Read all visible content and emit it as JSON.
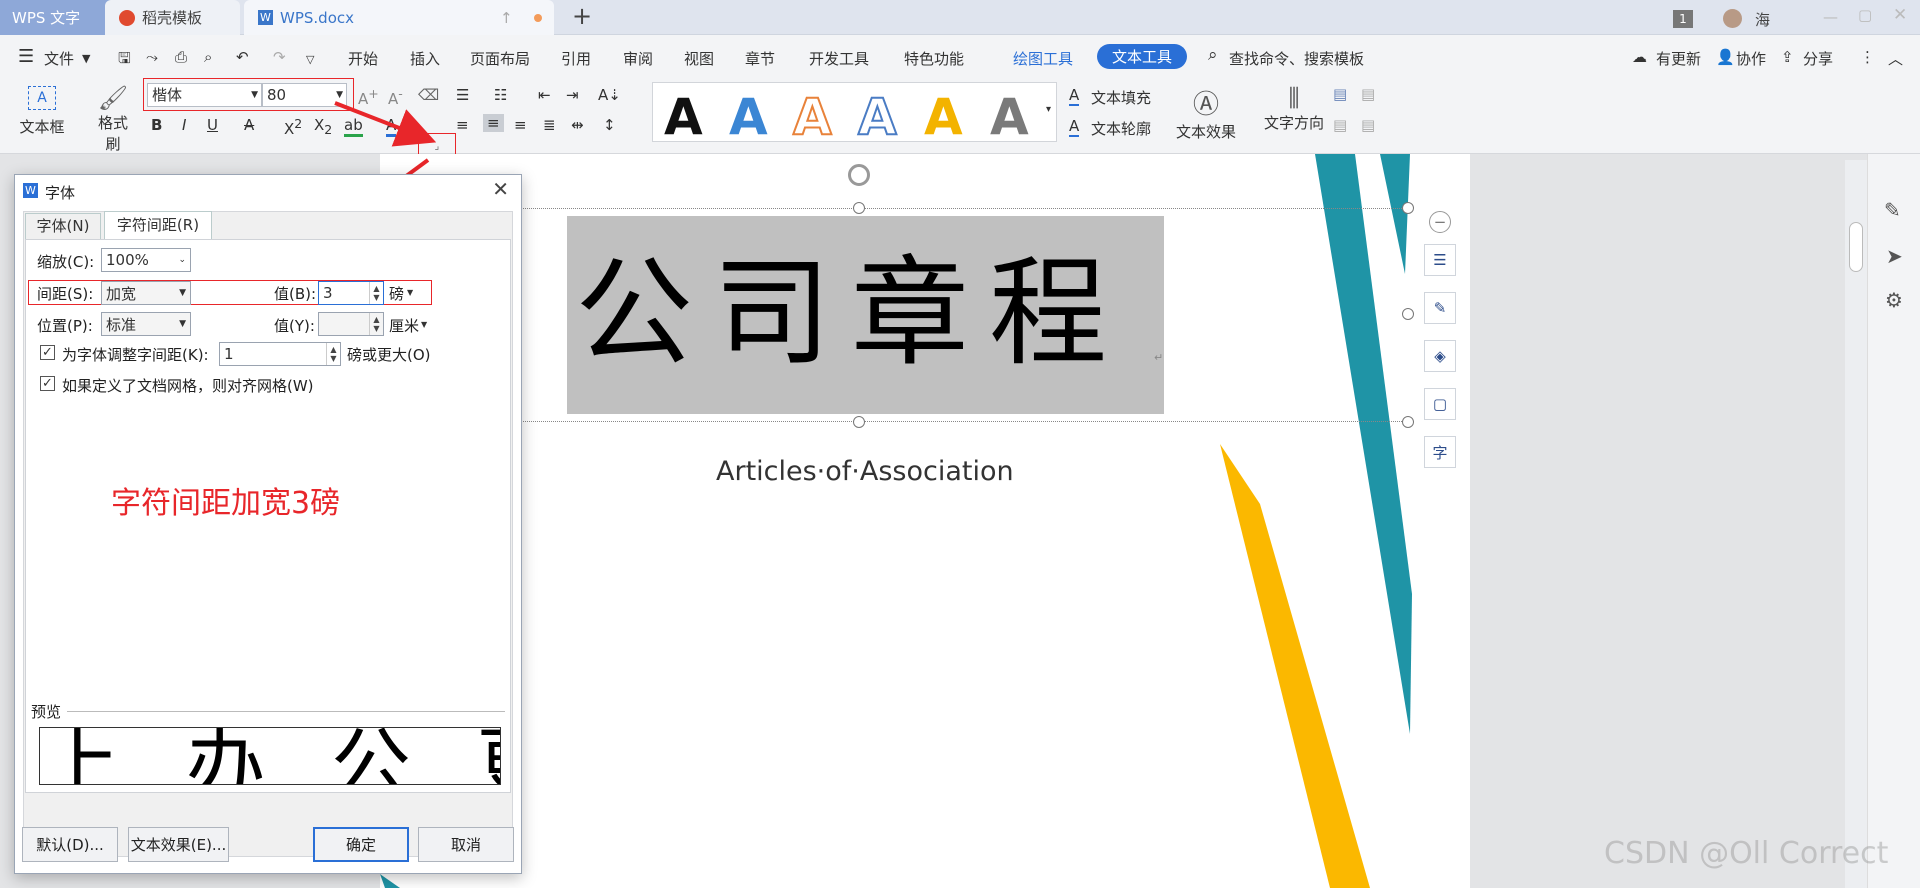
{
  "tabs": {
    "app": "WPS 文字",
    "template": "稻壳模板",
    "doc": "WPS.docx",
    "add": "+",
    "page_badge": "1",
    "user": "海"
  },
  "menu": {
    "file": "文件",
    "items": [
      "开始",
      "插入",
      "页面布局",
      "引用",
      "审阅",
      "视图",
      "章节",
      "开发工具",
      "特色功能",
      "绘图工具"
    ],
    "active_tab": "文本工具",
    "search": "查找命令、搜索模板",
    "update": "有更新",
    "collab": "协作",
    "share": "分享"
  },
  "toolbar": {
    "textbox": "文本框",
    "format_painter": "格式刷",
    "font": "楷体",
    "font_size": "80",
    "text_fill": "文本填充",
    "text_outline": "文本轮廓",
    "text_effect": "文本效果",
    "text_direction": "文字方向",
    "style_letter": "A",
    "style_colors": [
      "#111111",
      "#3b86d4",
      "#e8823a",
      "#4a7cc4",
      "#f3b300",
      "#7a7a7a"
    ]
  },
  "document": {
    "title": "公司章程",
    "subtitle": "Articles·of·Association",
    "para_mark": "↵"
  },
  "dialog": {
    "title": "字体",
    "tab_font": "字体(N)",
    "tab_spacing": "字符间距(R)",
    "scale_label": "缩放(C):",
    "scale_value": "100%",
    "spacing_label": "间距(S):",
    "spacing_value": "加宽",
    "spacing_amount_label": "值(B):",
    "spacing_amount": "3",
    "spacing_unit": "磅",
    "position_label": "位置(P):",
    "position_value": "标准",
    "position_amount_label": "值(Y):",
    "position_amount": "",
    "position_unit": "厘米",
    "kerning_label": "为字体调整字间距(K):",
    "kerning_value": "1",
    "kerning_unit": "磅或更大(O)",
    "grid_label": "如果定义了文档网格，则对齐网格(W)",
    "annotation": "字符间距加宽3磅",
    "preview_label": "预览",
    "preview_text": "上 办 公 更",
    "btn_default": "默认(D)...",
    "btn_effects": "文本效果(E)...",
    "btn_ok": "确定",
    "btn_cancel": "取消"
  },
  "watermark": "CSDN @Oll Correct",
  "colors": {
    "accent": "#2a6fd6",
    "annotation_red": "#e8262a",
    "teal": "#1f94a6",
    "gold": "#fbb800"
  }
}
